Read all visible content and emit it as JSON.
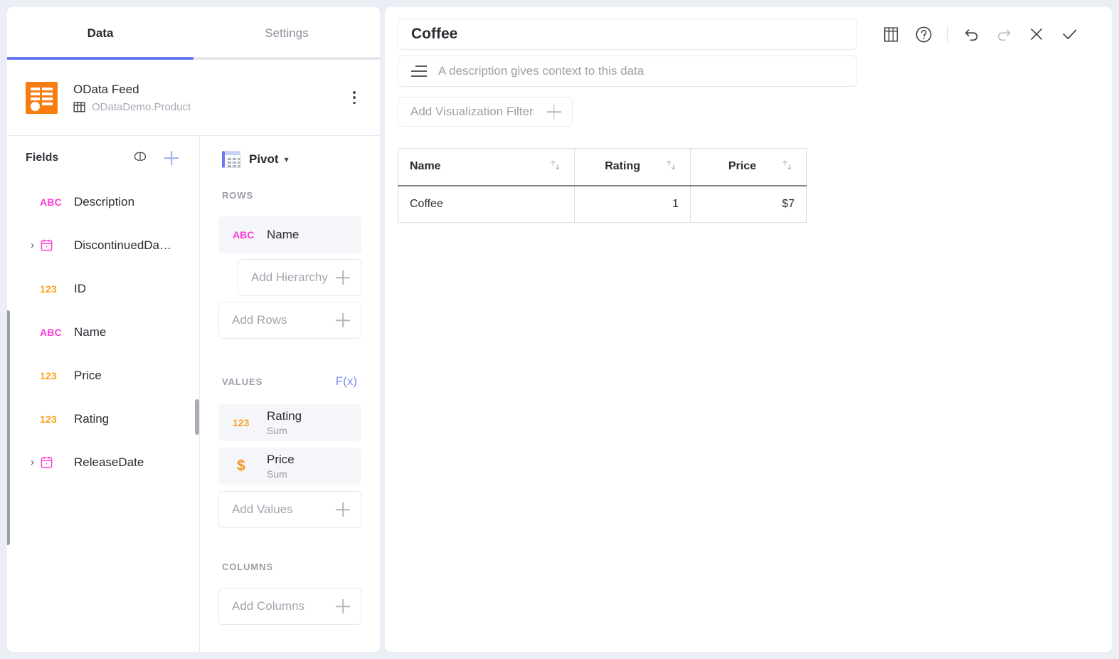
{
  "left": {
    "tabs": [
      {
        "label": "Data",
        "active": true
      },
      {
        "label": "Settings",
        "active": false
      }
    ],
    "source": {
      "icon": "odata-feed-icon",
      "title": "OData Feed",
      "table_icon": "table-icon",
      "table": "ODataDemo.Product",
      "menu_icon": "kebab-menu-icon"
    },
    "fields": {
      "title": "Fields",
      "ai_icon": "brain-icon",
      "add_icon": "plus-icon",
      "items": [
        {
          "type": "ABC",
          "label": "Description",
          "expandable": false
        },
        {
          "type": "calendar",
          "label": "DiscontinuedDa…",
          "expandable": true
        },
        {
          "type": "123",
          "label": "ID",
          "expandable": false
        },
        {
          "type": "ABC",
          "label": "Name",
          "expandable": false
        },
        {
          "type": "123",
          "label": "Price",
          "expandable": false
        },
        {
          "type": "123",
          "label": "Rating",
          "expandable": false
        },
        {
          "type": "calendar",
          "label": "ReleaseDate",
          "expandable": true
        }
      ]
    },
    "pivot": {
      "icon": "pivot-table-icon",
      "name": "Pivot",
      "caret": "⌄",
      "rows": {
        "label": "ROWS",
        "chips": [
          {
            "type": "ABC",
            "label": "Name"
          }
        ],
        "add_hierarchy": "Add Hierarchy",
        "add_rows": "Add Rows"
      },
      "values": {
        "label": "VALUES",
        "fx": "F(x)",
        "chips": [
          {
            "type": "123",
            "label": "Rating",
            "agg": "Sum"
          },
          {
            "type": "dollar",
            "label": "Price",
            "agg": "Sum"
          }
        ],
        "add_values": "Add Values"
      },
      "columns": {
        "label": "COLUMNS",
        "add_columns": "Add Columns"
      }
    }
  },
  "right": {
    "title": "Coffee",
    "description_placeholder": "A description gives context to this data",
    "description_icon": "description-lines-icon",
    "filter_label": "Add Visualization Filter",
    "toolbar": [
      {
        "name": "table-view-icon",
        "label": "table-view",
        "disabled": false
      },
      {
        "name": "help-icon",
        "label": "help",
        "disabled": false
      },
      {
        "name": "undo-icon",
        "label": "undo",
        "disabled": false
      },
      {
        "name": "redo-icon",
        "label": "redo",
        "disabled": true
      },
      {
        "name": "close-icon",
        "label": "close",
        "disabled": false
      },
      {
        "name": "confirm-icon",
        "label": "confirm",
        "disabled": false
      }
    ],
    "table": {
      "columns": [
        {
          "label": "Name",
          "align": "left"
        },
        {
          "label": "Rating",
          "align": "right"
        },
        {
          "label": "Price",
          "align": "right"
        }
      ],
      "rows": [
        {
          "name": "Coffee",
          "rating": "1",
          "price": "$7"
        }
      ],
      "sort_icon": "sort-arrows-icon"
    }
  },
  "colors": {
    "accent_blue": "#6878f0",
    "brand_orange": "#f97c10",
    "text_type": "#ff3dd8",
    "number_type": "#ffa01c",
    "page_bg": "#eceef6"
  }
}
